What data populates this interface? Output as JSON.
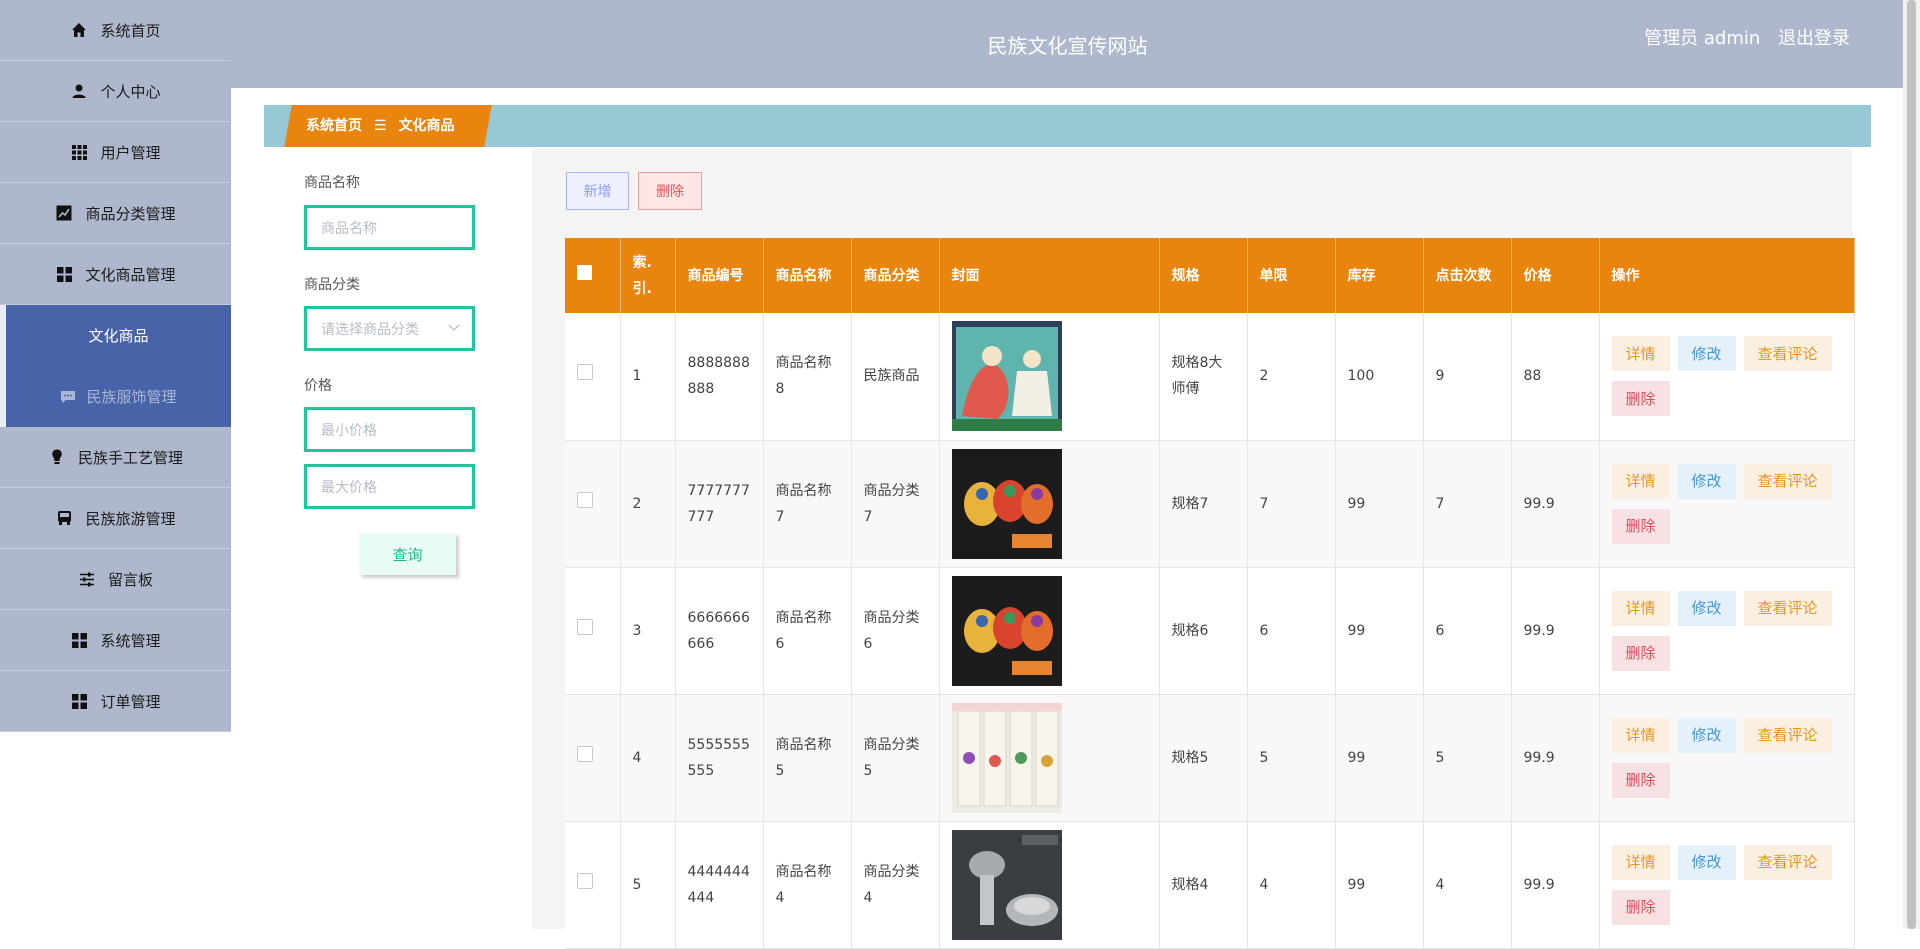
{
  "sidebar": {
    "items": [
      {
        "label": "系统首页",
        "icon": "home-icon"
      },
      {
        "label": "个人中心",
        "icon": "user-icon"
      },
      {
        "label": "用户管理",
        "icon": "grid-icon"
      },
      {
        "label": "商品分类管理",
        "icon": "chart-icon"
      },
      {
        "label": "文化商品管理",
        "icon": "apps-icon"
      },
      {
        "label": "民族手工艺管理",
        "icon": "bulb-icon"
      },
      {
        "label": "民族旅游管理",
        "icon": "bus-icon"
      },
      {
        "label": "留言板",
        "icon": "sliders-icon"
      },
      {
        "label": "系统管理",
        "icon": "apps-icon"
      },
      {
        "label": "订单管理",
        "icon": "apps-icon"
      }
    ],
    "subitems": [
      {
        "label": "文化商品"
      },
      {
        "label": "民族服饰管理",
        "icon": "chat-icon"
      }
    ]
  },
  "header": {
    "title": "民族文化宣传网站",
    "user": "管理员 admin",
    "logout": "退出登录"
  },
  "breadcrumb": {
    "home": "系统首页",
    "sep": "☰",
    "current": "文化商品"
  },
  "search": {
    "name_label": "商品名称",
    "name_placeholder": "商品名称",
    "category_label": "商品分类",
    "category_placeholder": "请选择商品分类",
    "price_label": "价格",
    "min_placeholder": "最小价格",
    "max_placeholder": "最大价格",
    "query": "查询"
  },
  "toolbar": {
    "add": "新增",
    "delete": "删除"
  },
  "table": {
    "headers": [
      "索.引.",
      "商品编号",
      "商品名称",
      "商品分类",
      "封面",
      "规格",
      "单限",
      "库存",
      "点击次数",
      "价格",
      "操作"
    ],
    "ops": {
      "detail": "详情",
      "edit": "修改",
      "review": "查看评论",
      "delete": "删除"
    },
    "rows": [
      {
        "index": "1",
        "code": "8888888888",
        "name": "商品名称8",
        "category": "民族商品",
        "spec": "规格8大师傅",
        "limit": "2",
        "stock": "100",
        "clicks": "9",
        "price": "88"
      },
      {
        "index": "2",
        "code": "7777777777",
        "name": "商品名称7",
        "category": "商品分类7",
        "spec": "规格7",
        "limit": "7",
        "stock": "99",
        "clicks": "7",
        "price": "99.9"
      },
      {
        "index": "3",
        "code": "6666666666",
        "name": "商品名称6",
        "category": "商品分类6",
        "spec": "规格6",
        "limit": "6",
        "stock": "99",
        "clicks": "6",
        "price": "99.9"
      },
      {
        "index": "4",
        "code": "5555555555",
        "name": "商品名称5",
        "category": "商品分类5",
        "spec": "规格5",
        "limit": "5",
        "stock": "99",
        "clicks": "5",
        "price": "99.9"
      },
      {
        "index": "5",
        "code": "4444444444",
        "name": "商品名称4",
        "category": "商品分类4",
        "spec": "规格4",
        "limit": "4",
        "stock": "99",
        "clicks": "4",
        "price": "99.9"
      }
    ]
  },
  "colors": {
    "accent": "#e9850c",
    "sidebar": "#aeb7cb",
    "active": "#4863a8",
    "input_border": "#22c49b"
  }
}
